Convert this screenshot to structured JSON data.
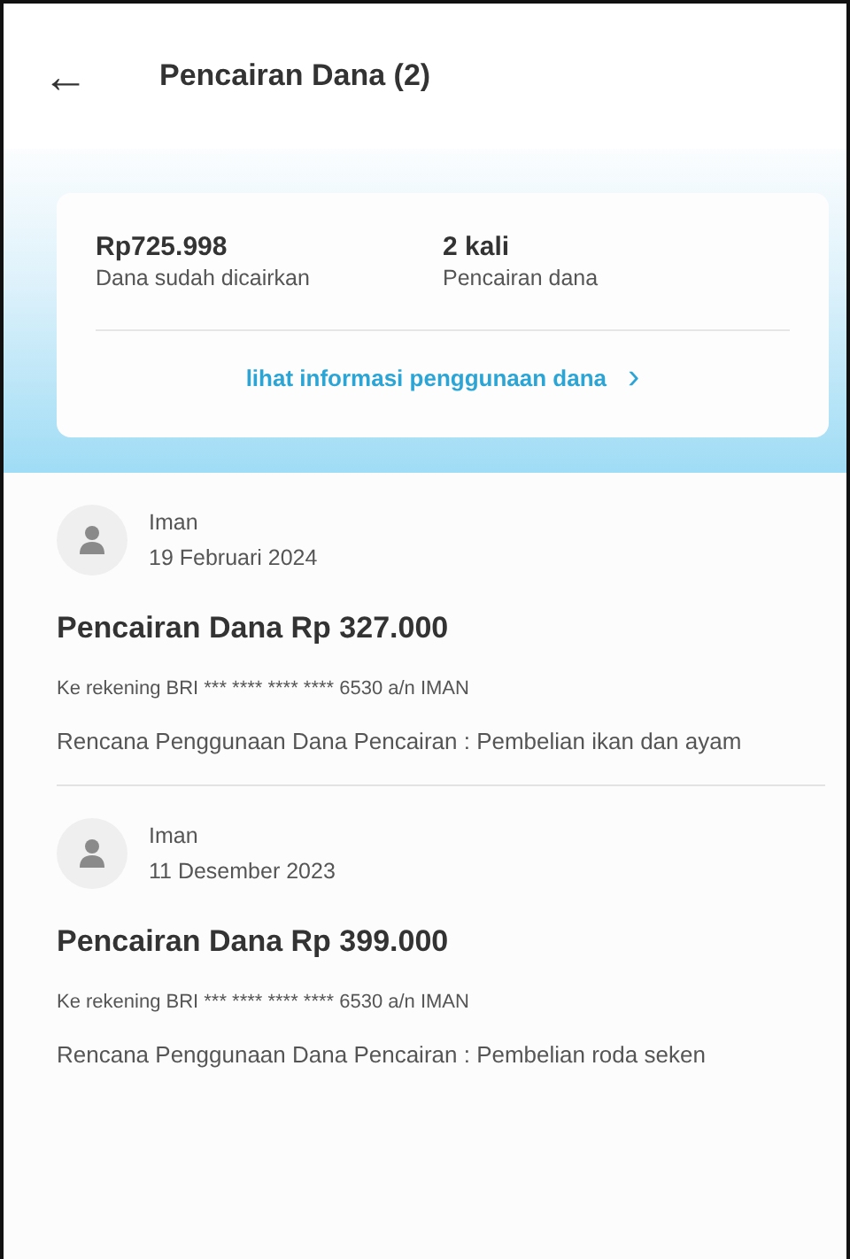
{
  "header": {
    "back": "←",
    "title": "Pencairan Dana (2)"
  },
  "summary": {
    "stats": [
      {
        "value": "Rp725.998",
        "label": "Dana sudah dicairkan"
      },
      {
        "value": "2 kali",
        "label": "Pencairan dana"
      }
    ],
    "link": {
      "label": "lihat informasi penggunaan dana",
      "chevron": "›"
    }
  },
  "disbursements": [
    {
      "name": "Iman",
      "date": "19 Februari 2024",
      "title": "Pencairan Dana Rp 327.000",
      "account": "Ke rekening BRI *** **** **** **** 6530 a/n IMAN",
      "plan": "Rencana Penggunaan Dana Pencairan : Pembelian ikan dan ayam"
    },
    {
      "name": "Iman",
      "date": "11 Desember 2023",
      "title": "Pencairan Dana Rp 399.000",
      "account": "Ke rekening BRI *** **** **** **** 6530 a/n IMAN",
      "plan": "Rencana Penggunaan Dana Pencairan : Pembelian roda seken"
    }
  ]
}
